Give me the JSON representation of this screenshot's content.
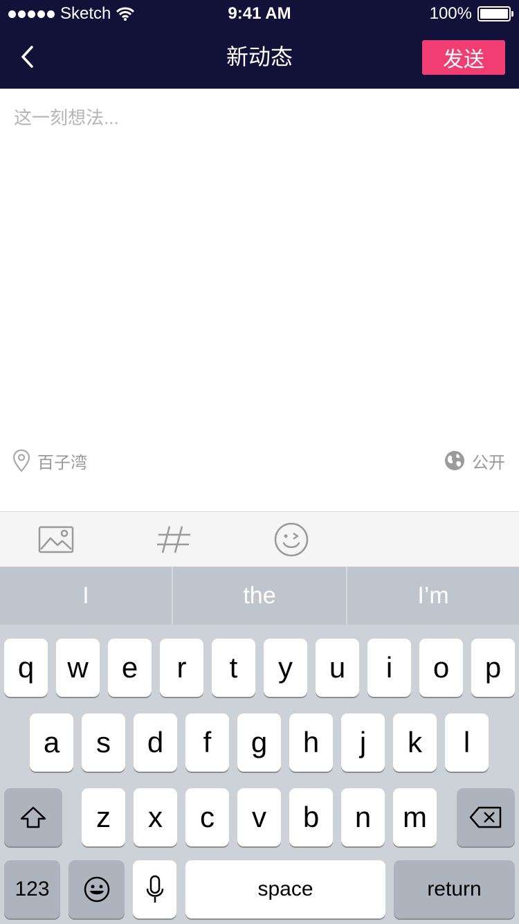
{
  "status_bar": {
    "carrier": "Sketch",
    "time": "9:41 AM",
    "battery": "100%"
  },
  "nav": {
    "title": "新动态",
    "send_label": "发送"
  },
  "editor": {
    "placeholder": "这一刻想法..."
  },
  "location": {
    "label": "百子湾"
  },
  "visibility": {
    "label": "公开"
  },
  "toolbar": {
    "icons": [
      "image-icon",
      "hashtag-icon",
      "emoji-icon"
    ]
  },
  "keyboard": {
    "suggestions": [
      "I",
      "the",
      "I’m"
    ],
    "row1": [
      "q",
      "w",
      "e",
      "r",
      "t",
      "y",
      "u",
      "i",
      "o",
      "p"
    ],
    "row2": [
      "a",
      "s",
      "d",
      "f",
      "g",
      "h",
      "j",
      "k",
      "l"
    ],
    "row3": [
      "z",
      "x",
      "c",
      "v",
      "b",
      "n",
      "m"
    ],
    "numbers_label": "123",
    "space_label": "space",
    "return_label": "return"
  },
  "colors": {
    "header_bg": "#12113a",
    "accent": "#f03d72"
  }
}
